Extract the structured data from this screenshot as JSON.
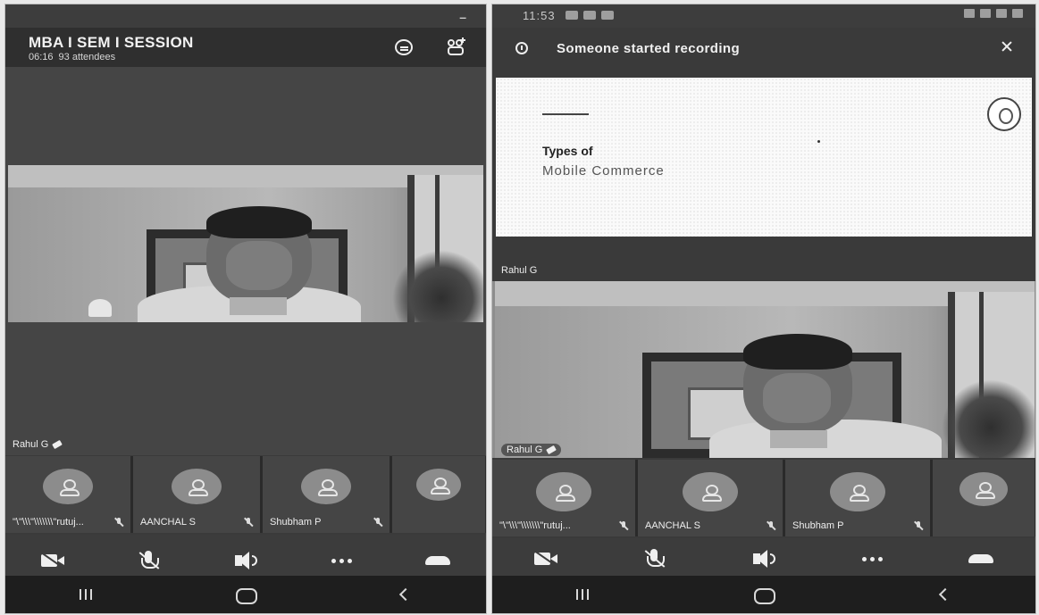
{
  "left_screen": {
    "status_bar": {
      "indicator": "–"
    },
    "meeting": {
      "title": "MBA I SEM I SESSION",
      "duration": "06:16",
      "attendees": "93 attendees"
    },
    "header_icons": [
      "chat-icon",
      "people-add-icon"
    ],
    "main_video": {
      "name": "Rahul G",
      "pinned": true
    },
    "participants": [
      {
        "name": "\"\\\"\\\\\\\"\\\\\\\\\\\\\\\"rutuj...",
        "muted": true
      },
      {
        "name": "AANCHAL S",
        "muted": true
      },
      {
        "name": "Shubham P",
        "muted": true
      },
      {
        "name": "",
        "muted": false
      }
    ],
    "controls": [
      "camera-off-icon",
      "mic-off-icon",
      "speaker-icon",
      "more-icon",
      "hangup-icon"
    ],
    "nav": [
      "recents-icon",
      "home-icon",
      "back-icon"
    ]
  },
  "right_screen": {
    "status_bar": {
      "time": "11:53"
    },
    "recording_banner": {
      "text": "Someone started recording"
    },
    "slide": {
      "title": "Types of",
      "subtitle": "Mobile Commerce"
    },
    "presenter_label": "Rahul G",
    "main_video": {
      "name": "Rahul G",
      "pinned": true
    },
    "participants": [
      {
        "name": "\"\\\"\\\\\\\"\\\\\\\\\\\\\\\"rutuj...",
        "muted": true
      },
      {
        "name": "AANCHAL S",
        "muted": true
      },
      {
        "name": "Shubham P",
        "muted": true
      },
      {
        "name": "",
        "muted": false
      }
    ],
    "controls": [
      "camera-off-icon",
      "mic-off-icon",
      "speaker-icon",
      "more-icon",
      "hangup-icon"
    ],
    "nav": [
      "recents-icon",
      "home-icon",
      "back-icon"
    ]
  }
}
